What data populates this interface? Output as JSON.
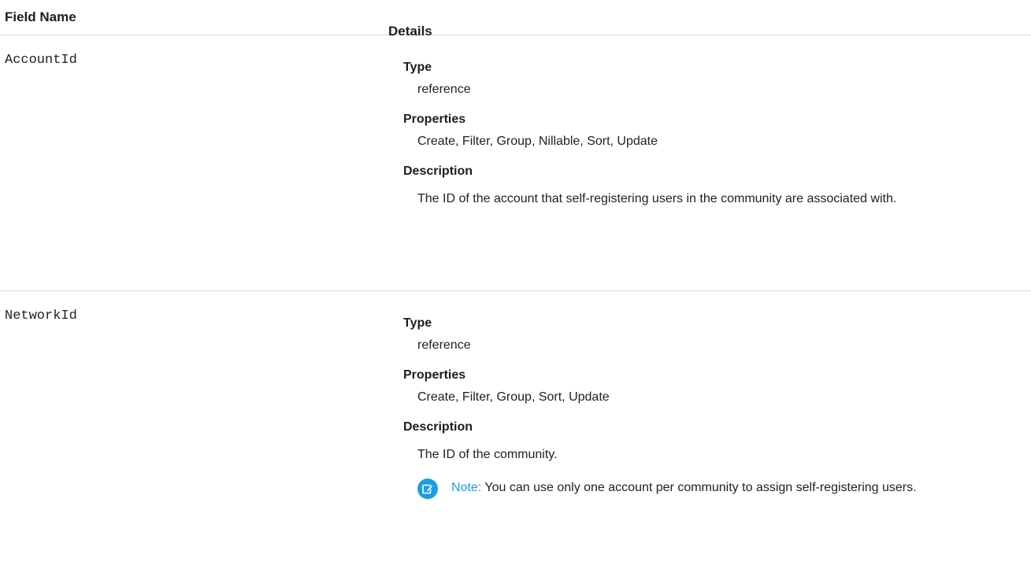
{
  "table": {
    "header": {
      "field_name": "Field Name",
      "details": "Details"
    },
    "rows": [
      {
        "field_name": "AccountId",
        "type_label": "Type",
        "type_value": "reference",
        "properties_label": "Properties",
        "properties_value": "Create, Filter, Group, Nillable, Sort, Update",
        "description_label": "Description",
        "description_value": "The ID of the account that self-registering users in the community are associated with."
      },
      {
        "field_name": "NetworkId",
        "type_label": "Type",
        "type_value": "reference",
        "properties_label": "Properties",
        "properties_value": "Create, Filter, Group, Sort, Update",
        "description_label": "Description",
        "description_value": "The ID of the community.",
        "note": {
          "label": "Note:",
          "text": "You can use only one account per community to assign self-registering users.",
          "icon": "edit-note-icon",
          "accent_color": "#1b9fe0"
        }
      }
    ]
  }
}
